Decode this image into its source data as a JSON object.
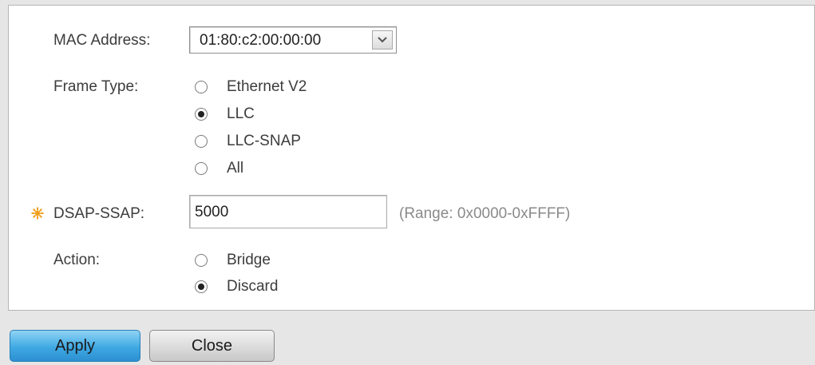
{
  "form": {
    "mac_address": {
      "label": "MAC Address:",
      "selected": "01:80:c2:00:00:00"
    },
    "frame_type": {
      "label": "Frame Type:",
      "options": [
        "Ethernet V2",
        "LLC",
        "LLC-SNAP",
        "All"
      ],
      "selected": "LLC"
    },
    "dsap_ssap": {
      "label": "DSAP-SSAP:",
      "value": "5000",
      "hint": "(Range: 0x0000-0xFFFF)",
      "required": true
    },
    "action": {
      "label": "Action:",
      "options": [
        "Bridge",
        "Discard"
      ],
      "selected": "Discard"
    }
  },
  "buttons": {
    "apply": "Apply",
    "close": "Close"
  },
  "colors": {
    "apply_button": "#3fa9e3",
    "required_icon": "#f0a020"
  }
}
